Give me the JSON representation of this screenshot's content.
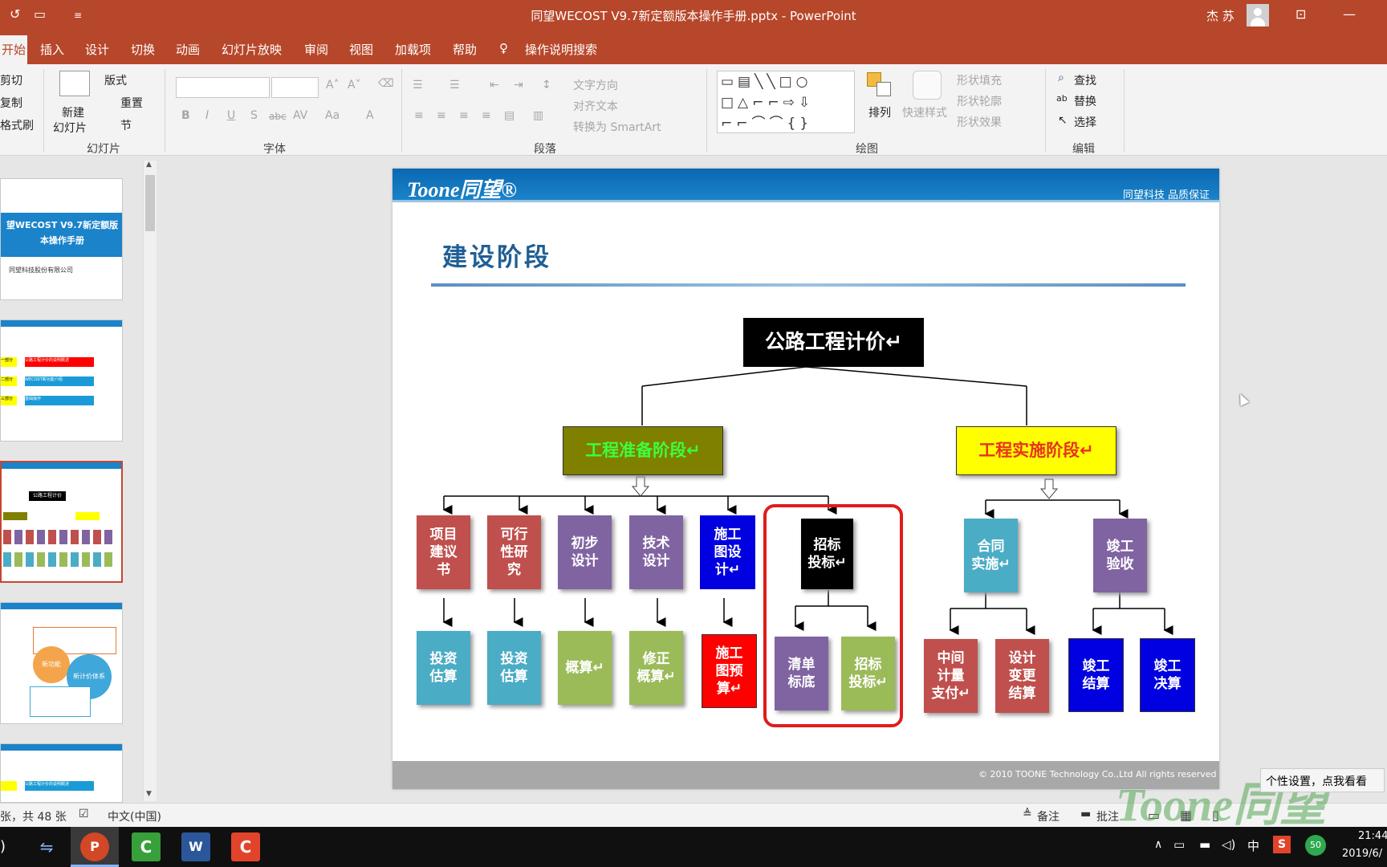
{
  "window": {
    "title": "同望WECOST V9.7新定额版本操作手册.pptx  -  PowerPoint",
    "user": "杰 苏"
  },
  "tabs": [
    "开始",
    "插入",
    "设计",
    "切换",
    "动画",
    "幻灯片放映",
    "审阅",
    "视图",
    "加载项",
    "帮助",
    "操作说明搜索"
  ],
  "ribbon": {
    "clipboard": {
      "cut": "剪切",
      "copy": "复制",
      "painter": "格式刷"
    },
    "slides": {
      "new_slide_1": "新建",
      "new_slide_2": "幻灯片",
      "layout": "版式",
      "reset": "重置",
      "section": "节",
      "group_label": "幻灯片"
    },
    "font": {
      "group_label": "字体",
      "bold": "B",
      "italic": "I",
      "underline": "U",
      "shadow": "S",
      "strike": "abc",
      "spacing": "AV",
      "case": "Aa",
      "color": "A"
    },
    "paragraph": {
      "group_label": "段落",
      "text_dir": "文字方向",
      "align_text": "对齐文本",
      "smartart": "转换为 SmartArt"
    },
    "drawing": {
      "group_label": "绘图",
      "arrange": "排列",
      "quick_styles": "快速样式",
      "fill": "形状填充",
      "outline": "形状轮廓",
      "effects": "形状效果"
    },
    "editing": {
      "group_label": "编辑",
      "find": "查找",
      "replace": "替换",
      "select": "选择"
    }
  },
  "thumbnails": {
    "t1_title": "望WECOST V9.7新定额版\n本操作手册",
    "t1_company": "同望科技股份有限公司",
    "t2_items": [
      "一部分",
      "二部分",
      "三部分"
    ],
    "t2_labels": [
      "公路工程计价的说明概述",
      "WECOST新功能介绍",
      "基础操作"
    ],
    "t3_title": "公路工程计价",
    "t4_items": [
      "新功能",
      "新计价体系"
    ],
    "t5_label": "公路工程计价的说明概述"
  },
  "slide": {
    "logo": "Toone同望®",
    "tagline": "同望科技  品质保证",
    "title": "建设阶段",
    "root": "公路工程计价↵",
    "phase_prep": "工程准备阶段↵",
    "phase_impl": "工程实施阶段↵",
    "prep_top": [
      "项目\n建议\n书",
      "可行\n性研\n究",
      "初步\n设计",
      "技术\n设计",
      "施工\n图设\n计↵"
    ],
    "prep_bottom": [
      "投资\n估算",
      "投资\n估算",
      "概算↵",
      "修正\n概算↵",
      "施工\n图预\n算↵"
    ],
    "bid_top": "招标\n投标↵",
    "bid_bottom": [
      "清单\n标底",
      "招标\n投标↵"
    ],
    "impl_top": [
      "合同\n实施↵",
      "竣工\n验收"
    ],
    "impl_bottom": [
      "中间\n计量\n支付↵",
      "设计\n变更\n结算",
      "竣工\n结算",
      "竣工\n决算"
    ],
    "copyright": "© 2010 TOONE  Technology Co.,Ltd  All rights reserved"
  },
  "status": {
    "slide_count": "张，共 48 张",
    "language": "中文(中国)",
    "notes": "备注",
    "comments": "批注"
  },
  "overlay": {
    "tip": "个性设置，点我看看",
    "watermark": "Toone同望"
  },
  "taskbar": {
    "time": "21:44",
    "date": "2019/6/",
    "ime": "中",
    "badge": "50"
  }
}
